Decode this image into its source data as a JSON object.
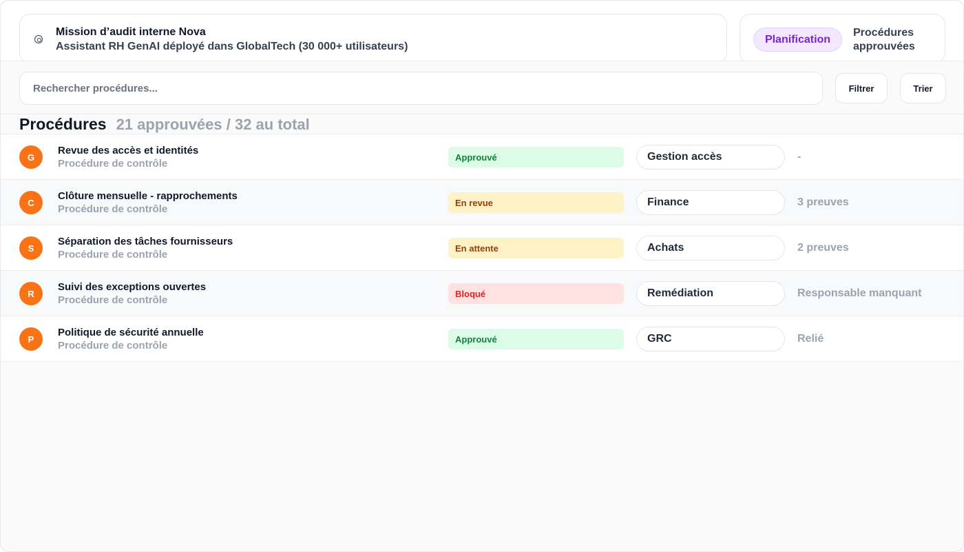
{
  "header": {
    "mission_title": "Mission d’audit interne Nova",
    "mission_subtitle": "Assistant RH GenAI déployé dans GlobalTech (30 000+ utilisateurs)",
    "mission_icon": "target-icon",
    "tabs": [
      {
        "label": "Planification",
        "active": true
      },
      {
        "label": "Procédures approuvées",
        "active": false
      }
    ]
  },
  "search": {
    "placeholder": "Rechercher procédures...",
    "value": ""
  },
  "toolbar": {
    "filter_label": "Filtrer",
    "sort_label": "Trier"
  },
  "section": {
    "title": "Procédures",
    "count_text": "21 approuvées / 32 au total"
  },
  "colors": {
    "avatar": "#f97316",
    "accent_purple": "#7e22ce",
    "status_green": "#15803d",
    "status_yellow": "#92400e",
    "status_red": "#dc2626"
  },
  "procedures": [
    {
      "initial": "G",
      "title": "Revue des accès et identités",
      "subtitle": "Procédure de contrôle",
      "status": "Approuvé",
      "status_tone": "green",
      "domain": "Gestion accès",
      "extra": "-"
    },
    {
      "initial": "C",
      "title": "Clôture mensuelle - rapprochements",
      "subtitle": "Procédure de contrôle",
      "status": "En revue",
      "status_tone": "yellow",
      "domain": "Finance",
      "extra": "3 preuves"
    },
    {
      "initial": "S",
      "title": "Séparation des tâches fournisseurs",
      "subtitle": "Procédure de contrôle",
      "status": "En attente",
      "status_tone": "yellow",
      "domain": "Achats",
      "extra": "2 preuves"
    },
    {
      "initial": "R",
      "title": "Suivi des exceptions ouvertes",
      "subtitle": "Procédure de contrôle",
      "status": "Bloqué",
      "status_tone": "red",
      "domain": "Remédiation",
      "extra": "Responsable manquant"
    },
    {
      "initial": "P",
      "title": "Politique de sécurité annuelle",
      "subtitle": "Procédure de contrôle",
      "status": "Approuvé",
      "status_tone": "green",
      "domain": "GRC",
      "extra": "Relié"
    }
  ]
}
